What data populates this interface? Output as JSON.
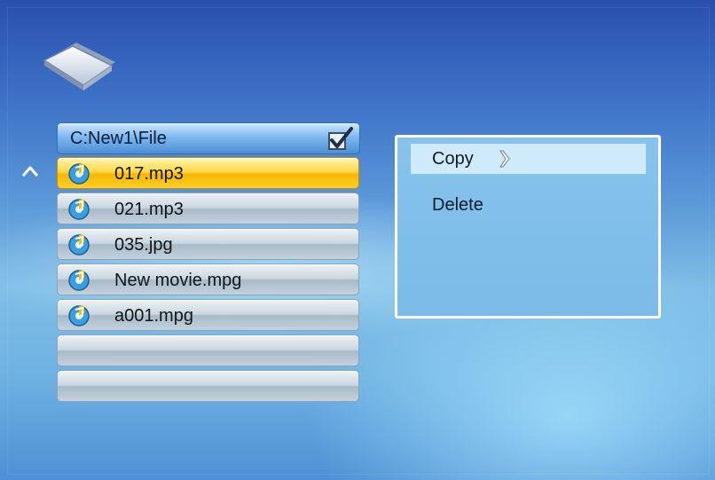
{
  "path": "C:New1\\File",
  "files": [
    {
      "name": "017.mp3",
      "selected": true
    },
    {
      "name": "021.mp3",
      "selected": false
    },
    {
      "name": "035.jpg",
      "selected": false
    },
    {
      "name": "New movie.mpg",
      "selected": false
    },
    {
      "name": "a001.mpg",
      "selected": false
    },
    {
      "name": "",
      "selected": false
    },
    {
      "name": "",
      "selected": false
    }
  ],
  "menu": {
    "copy_label": "Copy",
    "delete_label": "Delete",
    "highlighted": "Copy"
  },
  "colors": {
    "selected_row": "#ffd84a",
    "menu_bg": "#86c3ec",
    "menu_highlight": "#cfeafb"
  },
  "icons": {
    "header": "folder-icon",
    "path_check": "check-icon",
    "file": "music-disc-icon",
    "scroll_up": "up-arrow-icon",
    "copy_indicator": "chevron-right-icon"
  }
}
